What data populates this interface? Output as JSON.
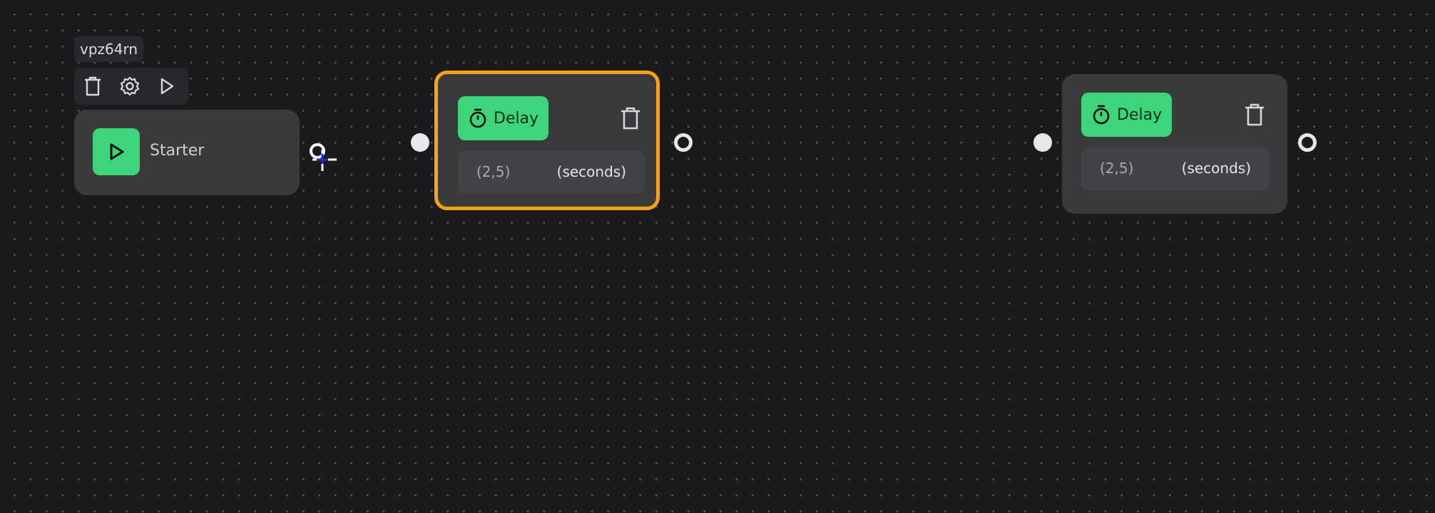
{
  "node_id": "vpz64rn",
  "toolbar": {
    "delete_icon": "trash-icon",
    "settings_icon": "gear-icon",
    "run_icon": "play-icon"
  },
  "starter": {
    "label": "Starter",
    "icon": "play-icon"
  },
  "delay_nodes": [
    {
      "button_label": "Delay",
      "icon": "stopwatch-icon",
      "value": "(2,5)",
      "unit": "(seconds)",
      "selected": true
    },
    {
      "button_label": "Delay",
      "icon": "stopwatch-icon",
      "value": "(2,5)",
      "unit": "(seconds)",
      "selected": false
    }
  ],
  "colors": {
    "background": "#1b1a1d",
    "node": "#3a393c",
    "accent_green": "#3ed47a",
    "selection_orange": "#f4a21a"
  }
}
